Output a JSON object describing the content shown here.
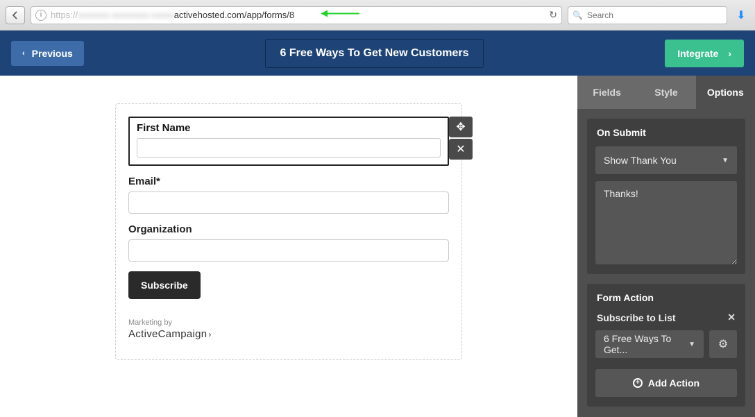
{
  "browser": {
    "url_scheme": "https://",
    "url_blur": "xxxxxxx-xxxxxxxx-xxxxx",
    "url_rest": "activehosted.com/app/forms/8",
    "search_placeholder": "Search"
  },
  "header": {
    "previous": "Previous",
    "title": "6 Free Ways To Get New Customers",
    "integrate": "Integrate"
  },
  "form": {
    "fields": [
      {
        "label": "First Name",
        "selected": true
      },
      {
        "label": "Email*",
        "selected": false
      },
      {
        "label": "Organization",
        "selected": false
      }
    ],
    "submit": "Subscribe",
    "marketing_by": "Marketing by",
    "brand": "ActiveCampaign"
  },
  "sidebar": {
    "tabs": {
      "fields": "Fields",
      "style": "Style",
      "options": "Options",
      "active": "options"
    },
    "on_submit": {
      "heading": "On Submit",
      "select_value": "Show Thank You",
      "message": "Thanks!"
    },
    "form_action": {
      "heading": "Form Action",
      "subheading": "Subscribe to List",
      "list_value": "6 Free Ways To Get...",
      "add_action": "Add Action"
    }
  },
  "icons": {
    "move": "✥",
    "close": "✕",
    "chevron_left": "‹",
    "chevron_right": "›",
    "caret_down": "▼",
    "gear": "⚙",
    "plus": "+",
    "reload": "↻",
    "search": "🔍",
    "download": "⬇",
    "info": "i"
  }
}
